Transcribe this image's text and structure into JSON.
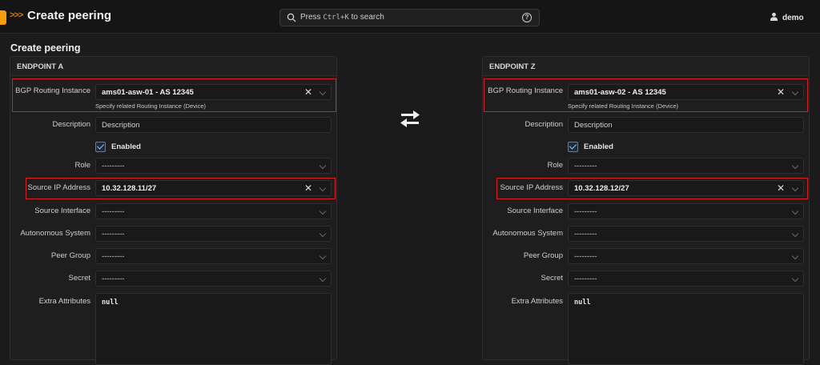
{
  "app": {
    "title": "Create peering",
    "logo_arrows": ">>>"
  },
  "search": {
    "prefix": "Press",
    "shortcut": "Ctrl+K",
    "suffix": "to search",
    "help_symbol": "?"
  },
  "user": {
    "name": "demo"
  },
  "page": {
    "title": "Create peering"
  },
  "icons": {
    "swap": "swap-arrows-icon",
    "search": "search-icon",
    "help": "help-circle-icon",
    "user": "user-icon",
    "clear": "close-icon",
    "chevron": "chevron-down-icon"
  },
  "colors": {
    "accent": "#f59e0b",
    "highlight": "#d61f26",
    "checkbox": "#3b82f6"
  },
  "endpoints": [
    {
      "heading": "ENDPOINT A",
      "bgp_label": "BGP Routing Instance",
      "bgp_value": "ams01-asw-01 - AS 12345",
      "bgp_help": "Specify related Routing Instance (Device)",
      "description_label": "Description",
      "description_placeholder": "Description",
      "enabled_label": "Enabled",
      "enabled": true,
      "role_label": "Role",
      "role_value": "---------",
      "source_ip_label": "Source IP Address",
      "source_ip_value": "10.32.128.11/27",
      "source_interface_label": "Source Interface",
      "source_interface_value": "---------",
      "as_label": "Autonomous System",
      "as_value": "---------",
      "peer_group_label": "Peer Group",
      "peer_group_value": "---------",
      "secret_label": "Secret",
      "secret_value": "---------",
      "extra_label": "Extra Attributes",
      "extra_value": "null"
    },
    {
      "heading": "ENDPOINT Z",
      "bgp_label": "BGP Routing Instance",
      "bgp_value": "ams01-asw-02 - AS 12345",
      "bgp_help": "Specify related Routing Instance (Device)",
      "description_label": "Description",
      "description_placeholder": "Description",
      "enabled_label": "Enabled",
      "enabled": true,
      "role_label": "Role",
      "role_value": "---------",
      "source_ip_label": "Source IP Address",
      "source_ip_value": "10.32.128.12/27",
      "source_interface_label": "Source Interface",
      "source_interface_value": "---------",
      "as_label": "Autonomous System",
      "as_value": "---------",
      "peer_group_label": "Peer Group",
      "peer_group_value": "---------",
      "secret_label": "Secret",
      "secret_value": "---------",
      "extra_label": "Extra Attributes",
      "extra_value": "null"
    }
  ]
}
